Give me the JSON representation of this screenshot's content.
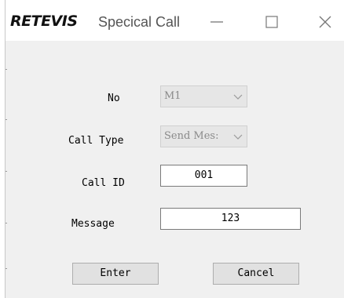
{
  "window": {
    "logo_text": "RETEVIS",
    "title": "Specical Call",
    "controls": {
      "minimize_icon": "minimize-icon",
      "maximize_icon": "maximize-icon",
      "close_icon": "close-icon"
    }
  },
  "form": {
    "no": {
      "label": "No",
      "value": "M1"
    },
    "call_type": {
      "label": "Call Type",
      "value": "Send Mes:"
    },
    "call_id": {
      "label": "Call ID",
      "value": "001"
    },
    "message": {
      "label": "Message",
      "value": "123"
    }
  },
  "buttons": {
    "enter_label": "Enter",
    "cancel_label": "Cancel"
  },
  "colors": {
    "client_bg": "#f0f0f0",
    "disabled_combo_bg": "#e6e6e6",
    "disabled_text": "#8a8a8a",
    "button_bg": "#e1e1e1"
  }
}
